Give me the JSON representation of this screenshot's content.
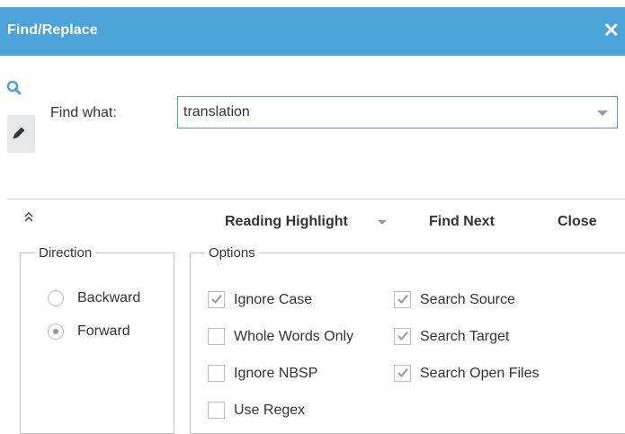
{
  "dialog": {
    "title": "Find/Replace",
    "close_icon": "close-icon"
  },
  "mode_tabs": [
    {
      "id": "find",
      "icon": "search-icon"
    },
    {
      "id": "replace",
      "icon": "pencil-icon"
    }
  ],
  "find": {
    "label": "Find what:",
    "value": "translation"
  },
  "actions": {
    "reading_highlight": "Reading Highlight",
    "find_next": "Find Next",
    "close": "Close"
  },
  "direction": {
    "legend": "Direction",
    "options": [
      {
        "label": "Backward",
        "selected": false
      },
      {
        "label": "Forward",
        "selected": true
      }
    ]
  },
  "options": {
    "legend": "Options",
    "items": [
      {
        "label": "Ignore Case",
        "checked": true
      },
      {
        "label": "Whole Words Only",
        "checked": false
      },
      {
        "label": "Ignore NBSP",
        "checked": false
      },
      {
        "label": "Use Regex",
        "checked": false
      },
      {
        "label": "Search Source",
        "checked": true
      },
      {
        "label": "Search Target",
        "checked": true
      },
      {
        "label": "Search Open Files",
        "checked": true
      }
    ]
  },
  "colors": {
    "accent": "#4ba3da",
    "checkmark": "#9a9a9a"
  }
}
